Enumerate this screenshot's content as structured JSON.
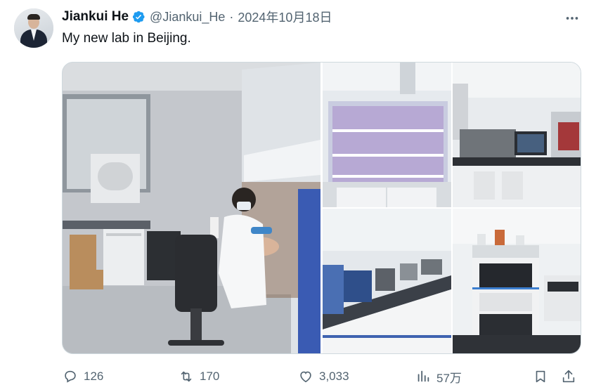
{
  "author": {
    "name": "Jiankui He",
    "handle": "@Jiankui_He",
    "verified": true,
    "avatar_icon": "profile-photo-man-in-suit"
  },
  "tweet": {
    "date": "2024年10月18日",
    "separator": "·",
    "text": "My new lab in Beijing.",
    "media_count": 5
  },
  "actions": {
    "replies": "126",
    "retweets": "170",
    "likes": "3,033",
    "views": "57万"
  },
  "icons": {
    "reply": "speech-bubble-icon",
    "retweet": "retweet-arrows-icon",
    "like": "heart-icon",
    "views": "bar-chart-icon",
    "bookmark": "bookmark-icon",
    "share": "share-upload-icon",
    "more": "more-horizontal-icon",
    "verified": "verified-badge-icon"
  },
  "colors": {
    "verified_blue": "#1d9bf0",
    "text_primary": "#0f1419",
    "text_secondary": "#536471",
    "border": "#cfd9de"
  }
}
